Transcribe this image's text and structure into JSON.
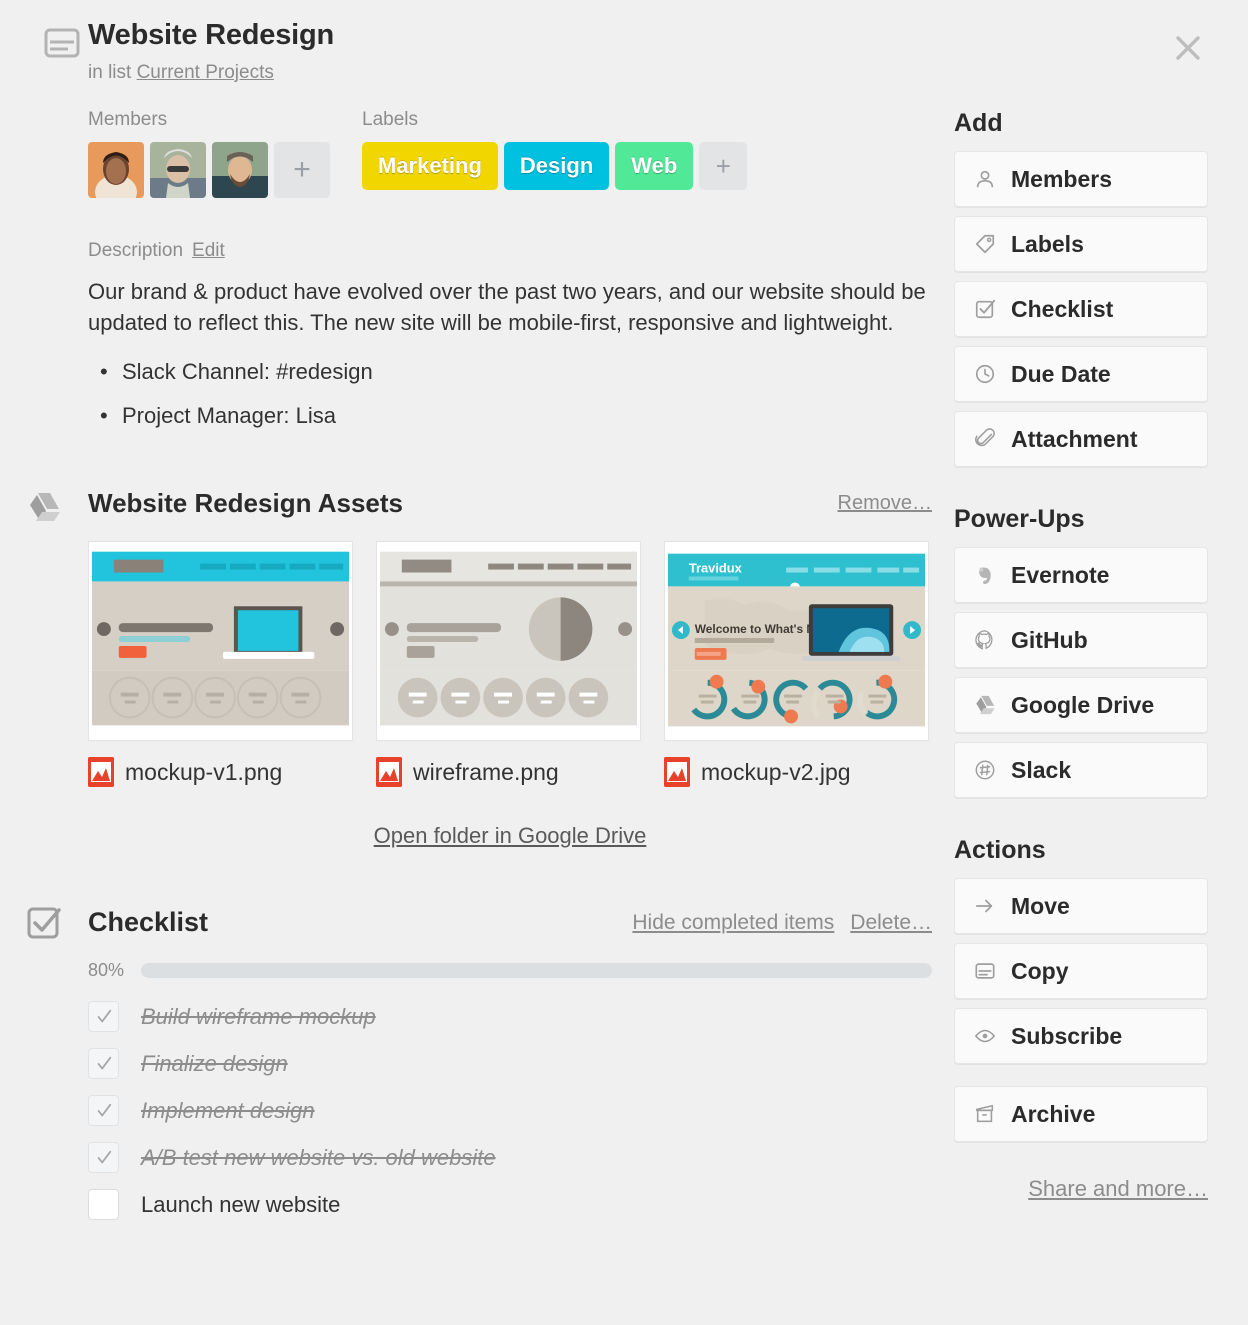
{
  "header": {
    "icon": "card-icon",
    "title": "Website Redesign",
    "in_list_prefix": "in list",
    "list_name": "Current Projects",
    "close_icon": "close-icon"
  },
  "members": {
    "label": "Members",
    "avatars": [
      {
        "name": "member-avatar-1",
        "bg": "#e8a163"
      },
      {
        "name": "member-avatar-2",
        "bg": "#9aa893"
      },
      {
        "name": "member-avatar-3",
        "bg": "#3d5a66"
      }
    ],
    "add_label": "+"
  },
  "labels": {
    "label": "Labels",
    "chips": [
      {
        "text": "Marketing",
        "color": "#f2d600"
      },
      {
        "text": "Design",
        "color": "#00c2e0"
      },
      {
        "text": "Web",
        "color": "#51e898"
      }
    ],
    "add_label": "+"
  },
  "description": {
    "heading": "Description",
    "edit_label": "Edit",
    "body": "Our brand & product have evolved over the past two years, and our website should be updated to reflect this. The new site will be mobile-first, responsive and lightweight.",
    "bullets": [
      "Slack Channel: #redesign",
      "Project Manager: Lisa"
    ]
  },
  "attachments": {
    "icon": "google-drive-icon",
    "title": "Website Redesign Assets",
    "remove_label": "Remove…",
    "items": [
      {
        "filename": "mockup-v1.png",
        "thumb": "mockup-v1"
      },
      {
        "filename": "wireframe.png",
        "thumb": "wireframe"
      },
      {
        "filename": "mockup-v2.jpg",
        "thumb": "mockup-v2"
      }
    ],
    "open_folder_label": "Open folder in Google Drive",
    "thumb3_brand": "Travidux",
    "thumb3_headline": "Welcome to What's Next"
  },
  "checklist": {
    "icon": "checklist-icon",
    "title": "Checklist",
    "hide_completed_label": "Hide completed items",
    "delete_label": "Delete…",
    "progress_percent": "80%",
    "progress_value": 80,
    "items": [
      {
        "text": "Build wireframe mockup",
        "checked": true
      },
      {
        "text": "Finalize design",
        "checked": true
      },
      {
        "text": "Implement design",
        "checked": true
      },
      {
        "text": "A/B test new website vs. old website",
        "checked": true
      },
      {
        "text": "Launch new website",
        "checked": false
      }
    ]
  },
  "sidebar": {
    "add_heading": "Add",
    "add_items": [
      {
        "label": "Members",
        "icon": "person-icon"
      },
      {
        "label": "Labels",
        "icon": "tag-icon"
      },
      {
        "label": "Checklist",
        "icon": "checkbox-icon"
      },
      {
        "label": "Due Date",
        "icon": "clock-icon"
      },
      {
        "label": "Attachment",
        "icon": "paperclip-icon"
      }
    ],
    "powerups_heading": "Power-Ups",
    "powerups_items": [
      {
        "label": "Evernote",
        "icon": "evernote-icon"
      },
      {
        "label": "GitHub",
        "icon": "github-icon"
      },
      {
        "label": "Google Drive",
        "icon": "google-drive-icon"
      },
      {
        "label": "Slack",
        "icon": "slack-icon"
      }
    ],
    "actions_heading": "Actions",
    "actions_items": [
      {
        "label": "Move",
        "icon": "arrow-right-icon"
      },
      {
        "label": "Copy",
        "icon": "card-icon"
      },
      {
        "label": "Subscribe",
        "icon": "eye-icon"
      },
      {
        "label": "Archive",
        "icon": "archive-icon"
      }
    ],
    "share_label": "Share and more…"
  }
}
